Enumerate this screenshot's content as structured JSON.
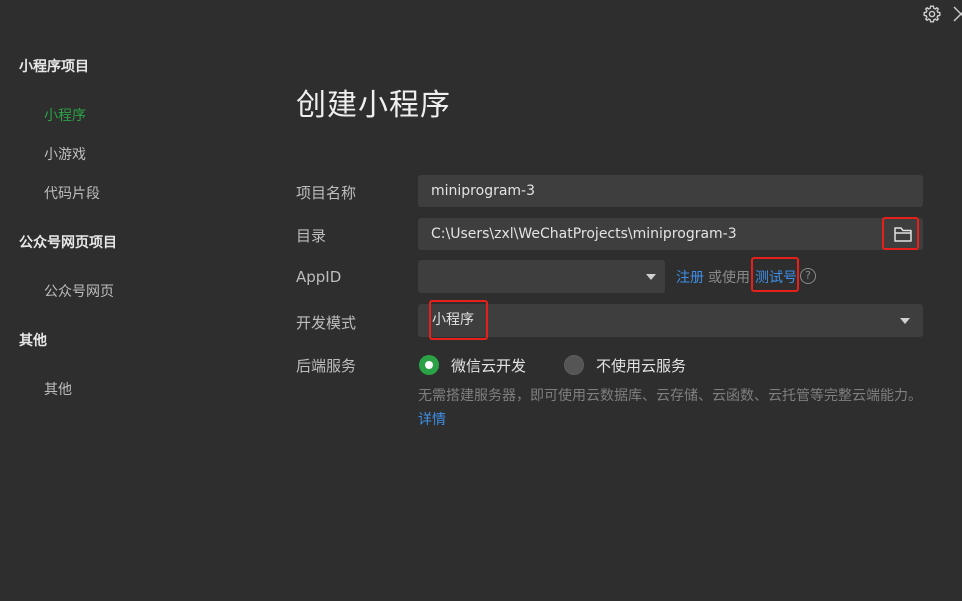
{
  "sidebar": {
    "groups": [
      {
        "label": "小程序项目",
        "items": [
          {
            "label": "小程序"
          },
          {
            "label": "小游戏"
          },
          {
            "label": "代码片段"
          }
        ]
      },
      {
        "label": "公众号网页项目",
        "items": [
          {
            "label": "公众号网页"
          }
        ]
      },
      {
        "label": "其他",
        "items": [
          {
            "label": "其他"
          }
        ]
      }
    ],
    "active_item": "小程序"
  },
  "main": {
    "title": "创建小程序",
    "fields": {
      "project_name": {
        "label": "项目名称",
        "value": "miniprogram-3"
      },
      "directory": {
        "label": "目录",
        "value": "C:\\Users\\zxl\\WeChatProjects\\miniprogram-3"
      },
      "appid": {
        "label": "AppID",
        "value": "",
        "register_link": "注册",
        "or_use": "或使用",
        "test_account_link": "测试号",
        "help": "?"
      },
      "dev_mode": {
        "label": "开发模式",
        "value": "小程序"
      },
      "backend": {
        "label": "后端服务",
        "options": [
          {
            "label": "微信云开发",
            "selected": true
          },
          {
            "label": "不使用云服务",
            "selected": false
          }
        ],
        "description": "无需搭建服务器，即可使用云数据库、云存储、云函数、云托管等完整云端能力。",
        "details_link": "详情"
      }
    }
  },
  "icons": {
    "settings": "gear-icon",
    "close": "close-icon",
    "folder": "folder-icon"
  },
  "colors": {
    "background": "#2e2e2e",
    "accent_green": "#2ba245",
    "link_blue": "#3f8ee6",
    "highlight_red": "#e8201c",
    "field_bg": "#3e3e3e"
  }
}
